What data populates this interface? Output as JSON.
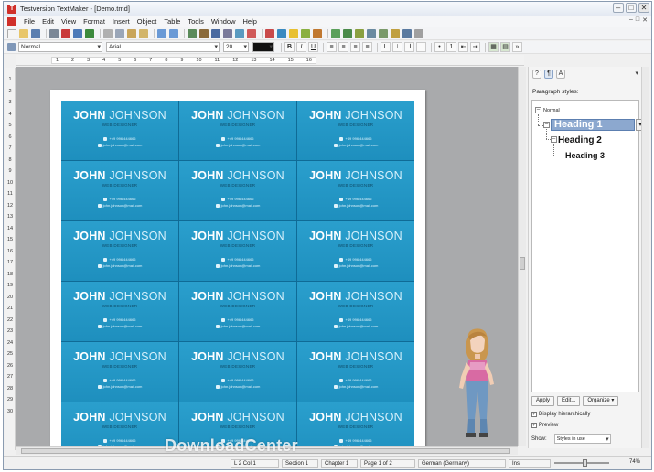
{
  "window": {
    "title": "Testversion TextMaker - [Demo.tmd]",
    "controls": [
      "–",
      "□",
      "✕"
    ]
  },
  "menubar": {
    "items": [
      "File",
      "Edit",
      "View",
      "Format",
      "Insert",
      "Object",
      "Table",
      "Tools",
      "Window",
      "Help"
    ]
  },
  "toolbar2": {
    "style_value": "Normal",
    "font_value": "Arial",
    "size_value": "20",
    "bold": "B",
    "italic": "I",
    "underline": "U"
  },
  "ruler": {
    "top_ticks": [
      "1",
      "2",
      "3",
      "4",
      "5",
      "6",
      "7",
      "8",
      "9",
      "10",
      "11",
      "12",
      "13",
      "14",
      "15",
      "16"
    ],
    "left_ticks": [
      "1",
      "2",
      "3",
      "4",
      "5",
      "6",
      "7",
      "8",
      "9",
      "10",
      "11",
      "12",
      "13",
      "14",
      "15",
      "16",
      "17",
      "18",
      "19",
      "20",
      "21",
      "22",
      "23",
      "24",
      "25",
      "26",
      "27",
      "28",
      "29",
      "30"
    ]
  },
  "card": {
    "first_name": "JOHN",
    "last_name": "JOHNSON",
    "role": "WEB DESIGNER",
    "phone": "+49 996 444666",
    "email": "john.johnson@mail.com"
  },
  "card_count": 18,
  "sidepane": {
    "paragraph_styles_label": "Paragraph styles:",
    "styles": {
      "normal": "Normal",
      "heading1": "Heading 1",
      "heading2": "Heading 2",
      "heading3": "Heading 3"
    },
    "buttons": {
      "apply": "Apply",
      "edit": "Edit...",
      "organize": "Organize"
    },
    "display_hierarchically": "Display hierarchically",
    "preview": "Preview",
    "show_label": "Show:",
    "show_value": "Styles in use"
  },
  "statusbar": {
    "position": "L 2 Col 1",
    "section": "Section 1",
    "chapter": "Chapter 1",
    "page": "Page 1 of 2",
    "language": "German (Germany)",
    "mode": "Ins",
    "zoom": "74%"
  },
  "watermark": "DownloadCenter",
  "colors": {
    "card_bg": "#2a9fcd",
    "heading1_highlight": "#8ca8cf",
    "doc_background": "#a9aaac"
  }
}
